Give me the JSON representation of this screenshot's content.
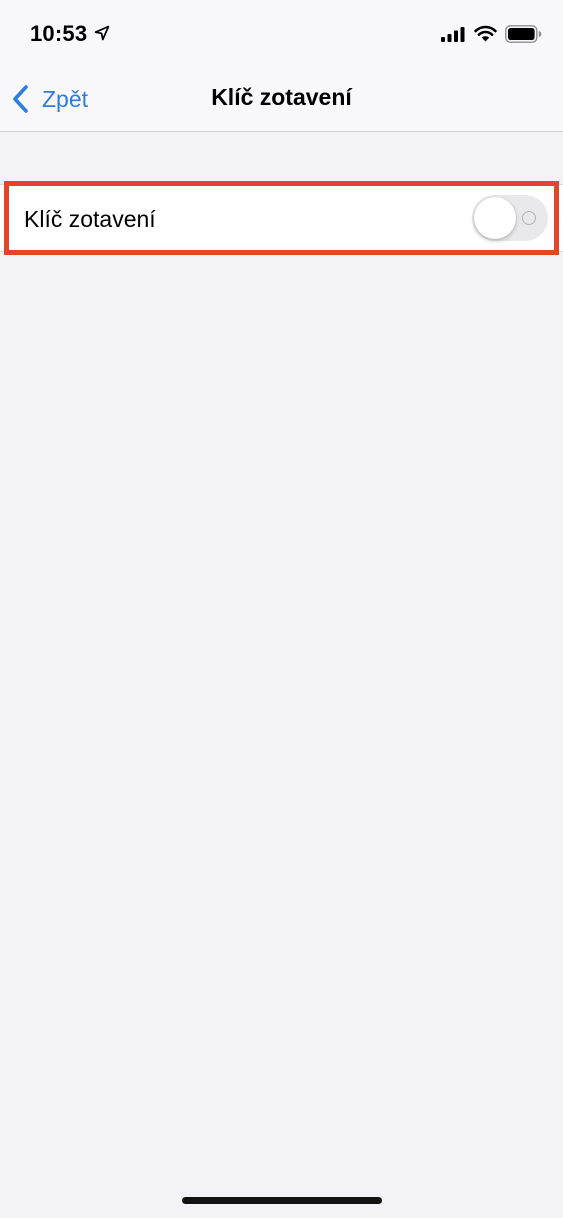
{
  "status_bar": {
    "time": "10:53",
    "location_icon": "location-arrow-icon",
    "signal_icon": "cellular-signal-icon",
    "wifi_icon": "wifi-icon",
    "battery_icon": "battery-icon"
  },
  "nav": {
    "back_label": "Zpět",
    "back_icon": "chevron-left-icon",
    "title": "Klíč zotavení"
  },
  "settings": {
    "recovery_key": {
      "label": "Klíč zotavení",
      "enabled": false
    }
  },
  "colors": {
    "accent": "#2f7de1",
    "highlight": "#e8432a",
    "background": "#f2f2f7",
    "toggle_off": "#e9e9eb"
  }
}
